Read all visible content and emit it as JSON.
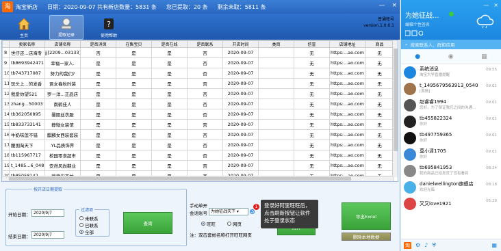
{
  "app": {
    "logo": "淘",
    "title": "淘宝新店",
    "date": "日期：2020-09-07 共有新店数量：5831 条",
    "extracted": "您已提取：20 条",
    "remaining": "剩余未取：5811 条",
    "window_controls": [
      "—",
      "×"
    ]
  },
  "toolbar": {
    "items": [
      {
        "label": "主页",
        "icon": "home-icon"
      },
      {
        "label": "提取记录",
        "icon": "records-icon"
      },
      {
        "label": "使用帮助",
        "icon": "help-icon"
      }
    ]
  },
  "version": {
    "line1": "普通帐号",
    "line2": "version.1.0.0.1"
  },
  "table": {
    "headers": [
      "卖家名称",
      "店铺名称",
      "是否消保",
      "在售宝贝",
      "是否在线",
      "是否联系",
      "开店时间",
      "类目",
      "信誉",
      "店铺地址",
      "商品"
    ],
    "rows": [
      [
        "8",
        "世仔还...店海专",
        "jj[2209...03133]",
        "否",
        "是",
        "是",
        "否",
        "2020-09-07",
        "",
        "无",
        "https:...ao.com",
        "无"
      ],
      [
        "9",
        "tb8693942471",
        "幸福一家人.",
        "是",
        "是",
        "是",
        "否",
        "2020-09-07",
        "",
        "无",
        "https:...ao.com",
        "无"
      ],
      [
        "10",
        "tb743717087",
        "努力的我们?",
        "是",
        "是",
        "是",
        "否",
        "2020-09-07",
        "",
        "无",
        "https:...ao.com",
        "无"
      ],
      [
        "11",
        "玩头上...的发香",
        "贾女春秋时装",
        "是",
        "是",
        "是",
        "否",
        "2020-09-07",
        "",
        "无",
        "https:...ao.com",
        "无"
      ],
      [
        "12",
        "我爱你望521",
        "罗一洋...正品店",
        "是",
        "是",
        "是",
        "否",
        "2020-09-07",
        "",
        "无",
        "https:...ao.com",
        "无"
      ],
      [
        "13",
        "zhang...50003",
        "南鹤佳人",
        "是",
        "是",
        "是",
        "否",
        "2020-09-07",
        "",
        "无",
        "https:...ao.com",
        "无"
      ],
      [
        "14",
        "tb362050895",
        "馨丽丝衣服",
        "是",
        "是",
        "是",
        "否",
        "2020-09-07",
        "",
        "无",
        "https:...ao.com",
        "无"
      ],
      [
        "15",
        "tb833733141",
        "静微女装馆",
        "是",
        "是",
        "是",
        "否",
        "2020-09-07",
        "",
        "无",
        "https:...ao.com",
        "无"
      ],
      [
        "16",
        "牛奶味莲不错",
        "麒麟女西装套装",
        "是",
        "是",
        "是",
        "否",
        "2020-09-07",
        "",
        "无",
        "https:...ao.com",
        "无"
      ],
      [
        "17",
        "腰围淘天下",
        "YL品质饰界",
        "是",
        "是",
        "是",
        "否",
        "2020-09-07",
        "",
        "无",
        "https:...ao.com",
        "无"
      ],
      [
        "18",
        "tb115967717",
        "校园零食超市",
        "是",
        "是",
        "是",
        "否",
        "2020-09-07",
        "",
        "无",
        "https:...ao.com",
        "无"
      ],
      [
        "19",
        "t_1485...6_0482",
        "安然风尚鞋业",
        "是",
        "是",
        "是",
        "否",
        "2020-09-07",
        "",
        "无",
        "https:...ao.com",
        "无"
      ],
      [
        "20",
        "tb85058142",
        "静静淘衣坊",
        "是",
        "是",
        "是",
        "否",
        "2020-09-07",
        "",
        "无",
        "https:...ao.com",
        "无"
      ]
    ]
  },
  "bottom": {
    "extract_group_label": "按开店日期提取",
    "start_label": "开始日期：",
    "start_date": "2020/9/7",
    "end_label": "结束日期：",
    "end_date": "2020/9/7",
    "filter_label": "过滤项",
    "filters": [
      {
        "label": "未联系",
        "on": false
      },
      {
        "label": "已联系",
        "on": false
      },
      {
        "label": "全部",
        "on": true
      }
    ],
    "query_button": "查询",
    "manual_label": "手动单开",
    "account_label": "会话账号",
    "account_value": "为她征战天下",
    "mode_options": [
      {
        "label": "旺旺",
        "on": true
      },
      {
        "label": "网页",
        "on": false
      }
    ],
    "note": "注：双击套帐名称打开旺旺网页",
    "open_button": "打开",
    "export_button": "导出Excel",
    "local_data_button": "删除本地数据",
    "badge": "1",
    "tooltip": "登录好阿里旺旺后，点击刷新按钮让软件处于登录状态"
  },
  "chat": {
    "nickname": "为她征战...",
    "signature": "编辑个性签名",
    "window_controls": [
      "—",
      "×"
    ],
    "search_placeholder": "搜索联系人、群和应用",
    "contacts": [
      {
        "name": "系统消息",
        "sub": "淘宝大学直播提醒",
        "time": "09:55",
        "color": "#1d87e0"
      },
      {
        "name": "t_1495679563913_0540",
        "sub": "[表情]",
        "time": "09:01",
        "color": "#a0744a"
      },
      {
        "name": "赵睿睿1994",
        "sub": "您好，为了保证我们之间的沟通...",
        "time": "09:01",
        "color": "#555"
      },
      {
        "name": "tb455822324",
        "sub": "你好",
        "time": "09:01",
        "color": "#222"
      },
      {
        "name": "tb497759365",
        "sub": "你好",
        "time": "09:01",
        "color": "#111"
      },
      {
        "name": "莫小清1705",
        "sub": "你好",
        "time": "09:01",
        "color": "#3a88d8"
      },
      {
        "name": "tb695841953",
        "sub": "我的商品已经发货了没有看到",
        "time": "08:24",
        "color": "#888"
      },
      {
        "name": "danielwellington旗舰店",
        "sub": "欢迎光临",
        "time": "08:18",
        "color": "#4ab0e8"
      },
      {
        "name": "又又love1921",
        "sub": "",
        "time": "05:29",
        "color": "#d44"
      }
    ]
  }
}
